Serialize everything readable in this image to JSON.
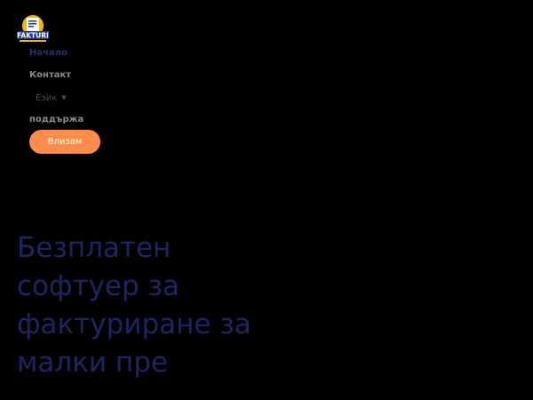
{
  "brand": {
    "logo_text": "FAKTURI",
    "colors": {
      "logo_blue": "#1f3a8a",
      "logo_yellow": "#f5b800",
      "accent_orange": "#ff8c4a",
      "title_navy": "#1e2460"
    }
  },
  "nav": {
    "items": [
      {
        "label": "Начало"
      },
      {
        "label": "Контакт"
      }
    ],
    "language": {
      "label": "Език",
      "icon": "caret-down-icon"
    },
    "support": {
      "label": "поддържа"
    },
    "login": {
      "label": "Влизам"
    }
  },
  "hero": {
    "title": "Безплатен\nсофтуер за\nфактуриране за\nмалки пре"
  }
}
